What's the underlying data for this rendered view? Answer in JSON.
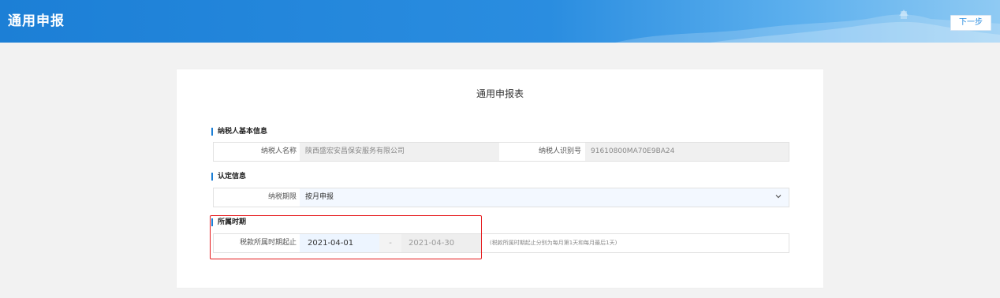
{
  "header": {
    "title": "通用申报",
    "next_label": "下一步"
  },
  "form": {
    "title": "通用申报表",
    "basic_info": {
      "heading": "纳税人基本信息",
      "taxpayer_name_label": "纳税人名称",
      "taxpayer_name_value": "陕西盛宏安昌保安服务有限公司",
      "taxpayer_id_label": "纳税人识别号",
      "taxpayer_id_value": "91610800MA70E9BA24"
    },
    "certification": {
      "heading": "认定信息",
      "period_label": "纳税期限",
      "period_value": "按月申报"
    },
    "tax_period": {
      "heading": "所属时期",
      "label": "税款所属时期起止",
      "start_date": "2021-04-01",
      "separator": "-",
      "end_date": "2021-04-30",
      "hint": "(税款所属时期起止分别为每月第1天和每月最后1天)"
    }
  },
  "colors": {
    "header_blue": "#1c7fd6",
    "highlight_red": "#e5181b",
    "page_bg": "#f2f2f2"
  },
  "icons": {
    "dropdown": "chevron-down-icon"
  }
}
